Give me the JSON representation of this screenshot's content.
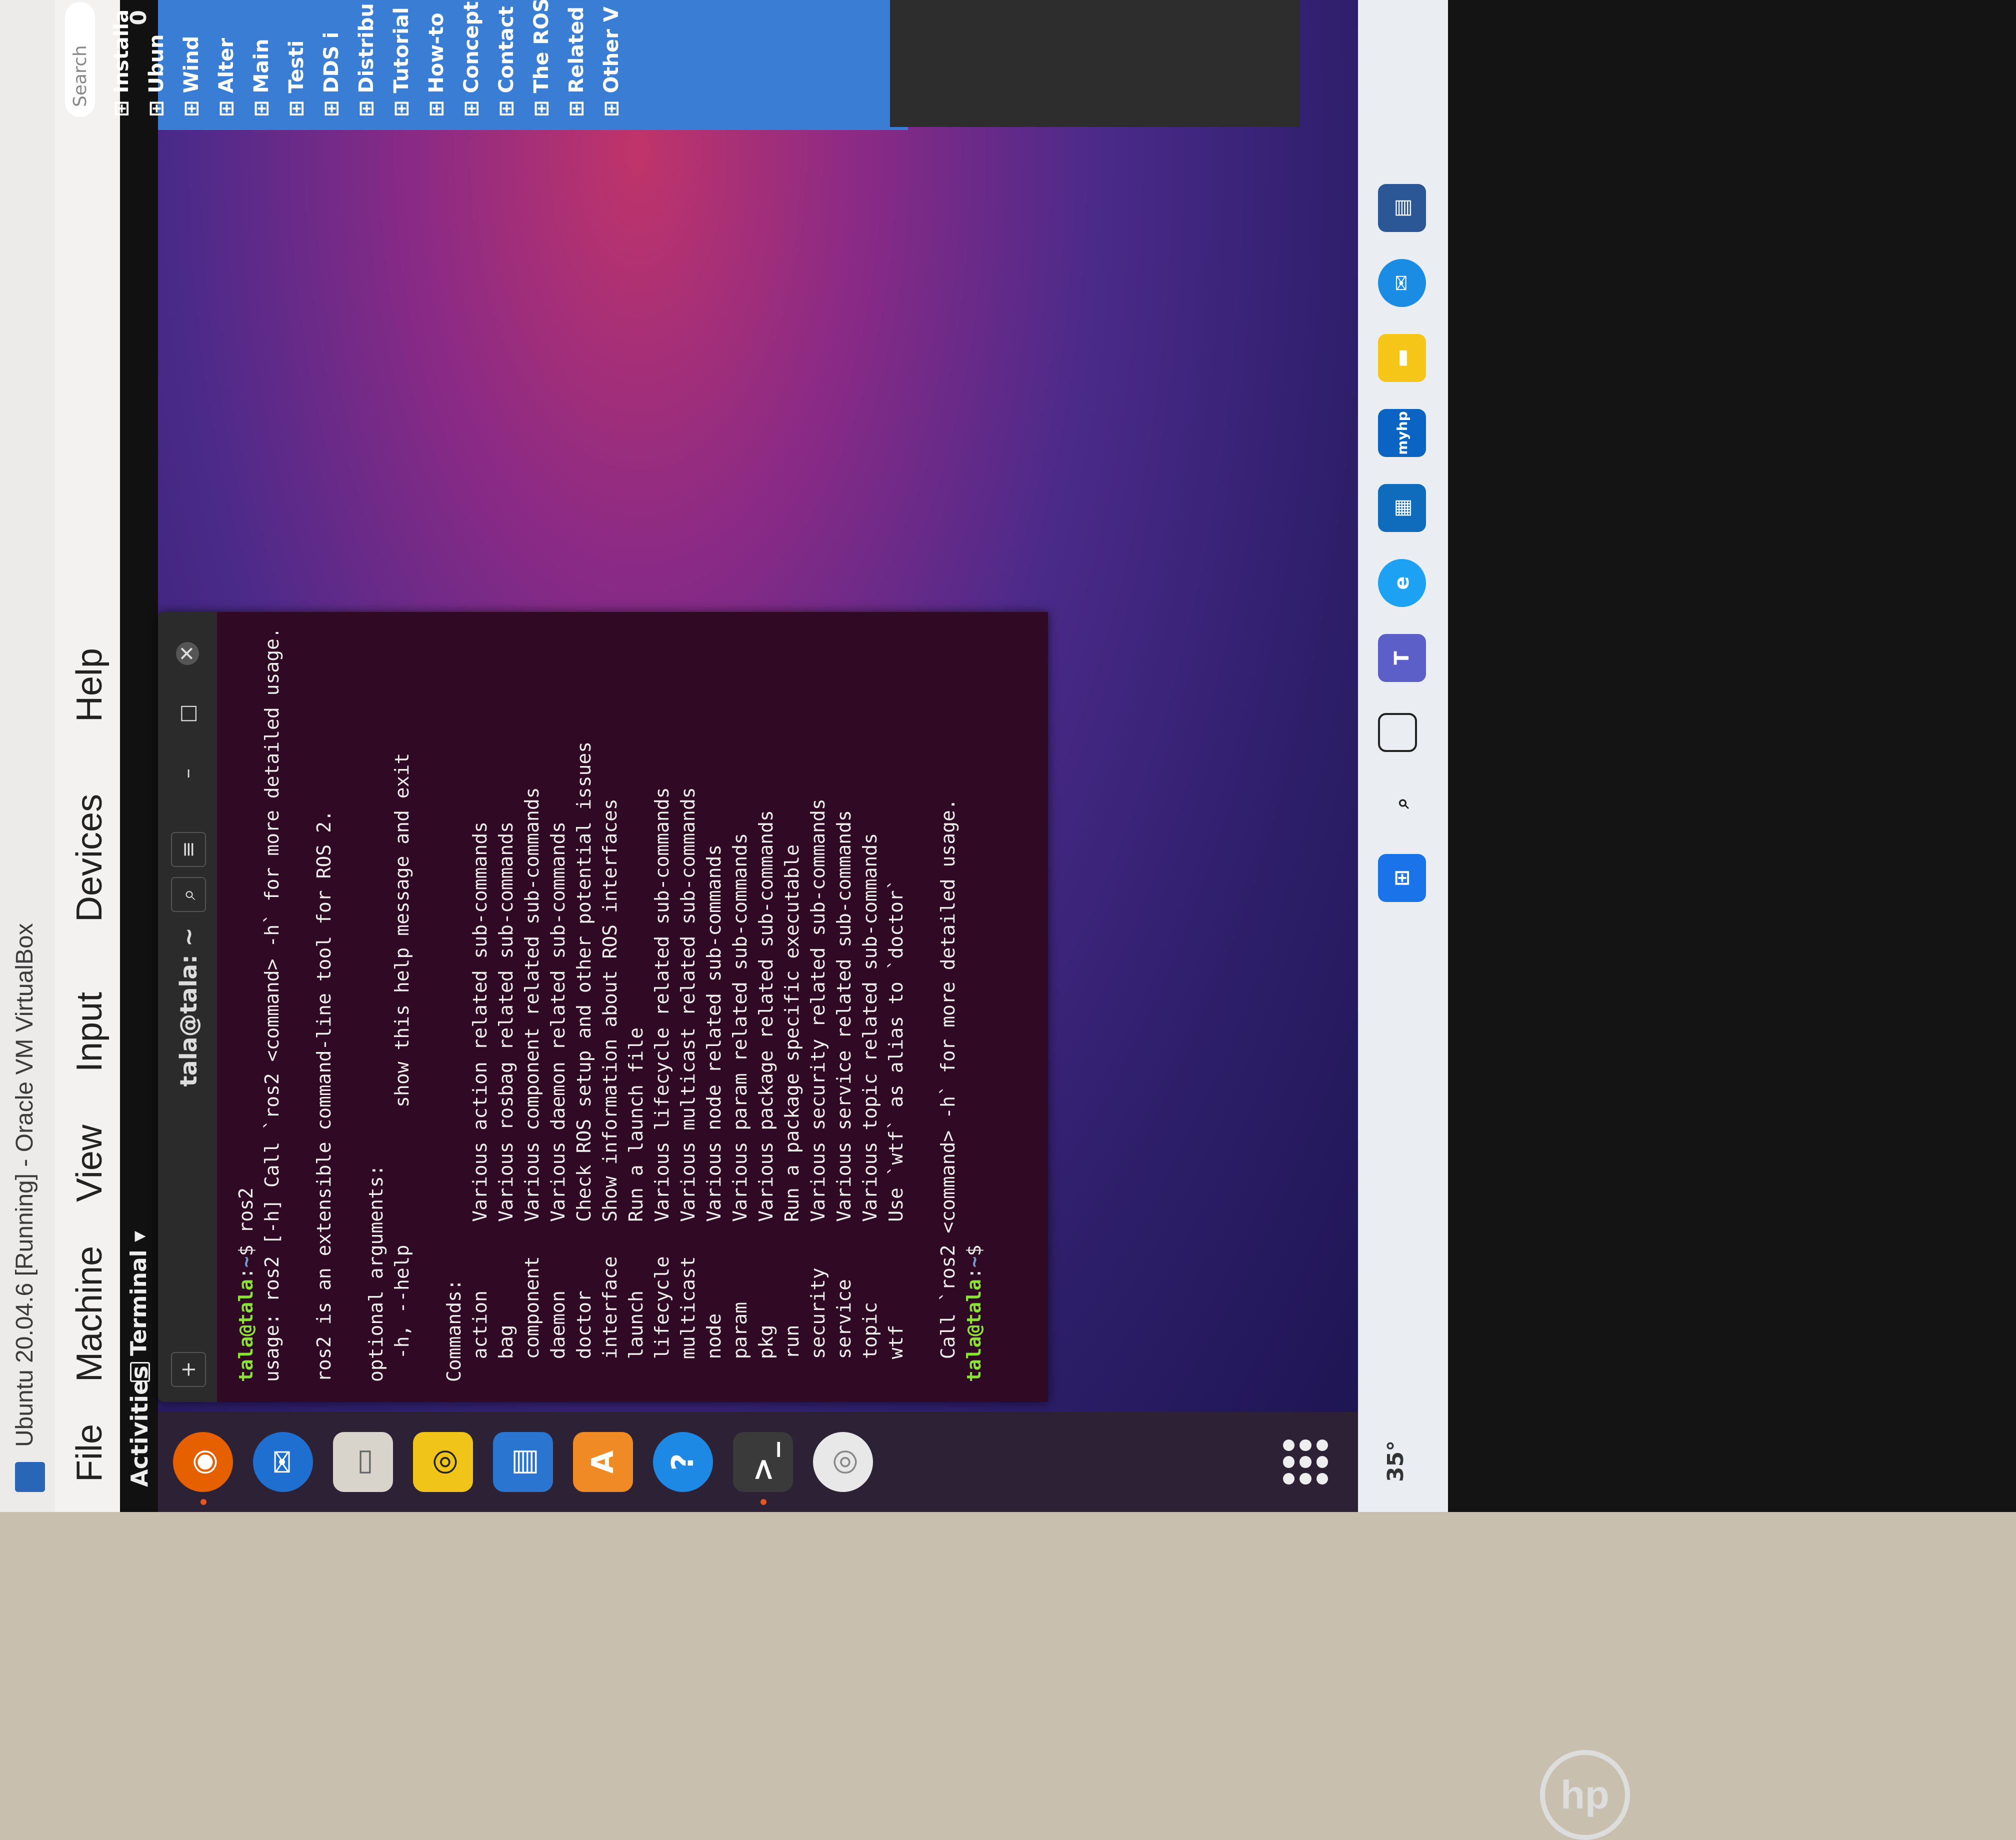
{
  "vbox": {
    "title": "Ubuntu 20.04.6 [Running] - Oracle VM VirtualBox",
    "menu": [
      "File",
      "Machine",
      "View",
      "Input",
      "Devices",
      "Help"
    ]
  },
  "topbar": {
    "activities": "Activities",
    "app_menu": "Terminal ▾",
    "clock": "0"
  },
  "terminal": {
    "title": "tala@tala: ~",
    "prompt_user": "tala@tala",
    "prompt_path": "~",
    "command": "ros2",
    "usage_line": "usage: ros2 [-h] Call `ros2 <command> -h` for more detailed usage. ...",
    "description": "ros2 is an extensible command-line tool for ROS 2.",
    "optional_header": "optional arguments:",
    "help_flag": "  -h, --help            show this help message and exit",
    "commands_header": "Commands:",
    "commands": [
      {
        "name": "action",
        "desc": "Various action related sub-commands"
      },
      {
        "name": "bag",
        "desc": "Various rosbag related sub-commands"
      },
      {
        "name": "component",
        "desc": "Various component related sub-commands"
      },
      {
        "name": "daemon",
        "desc": "Various daemon related sub-commands"
      },
      {
        "name": "doctor",
        "desc": "Check ROS setup and other potential issues"
      },
      {
        "name": "interface",
        "desc": "Show information about ROS interfaces"
      },
      {
        "name": "launch",
        "desc": "Run a launch file"
      },
      {
        "name": "lifecycle",
        "desc": "Various lifecycle related sub-commands"
      },
      {
        "name": "multicast",
        "desc": "Various multicast related sub-commands"
      },
      {
        "name": "node",
        "desc": "Various node related sub-commands"
      },
      {
        "name": "param",
        "desc": "Various param related sub-commands"
      },
      {
        "name": "pkg",
        "desc": "Various package related sub-commands"
      },
      {
        "name": "run",
        "desc": "Run a package specific executable"
      },
      {
        "name": "security",
        "desc": "Various security related sub-commands"
      },
      {
        "name": "service",
        "desc": "Various service related sub-commands"
      },
      {
        "name": "topic",
        "desc": "Various topic related sub-commands"
      },
      {
        "name": "wtf",
        "desc": "Use `wtf` as alias to `doctor`"
      }
    ],
    "footer": "  Call `ros2 <command> -h` for more detailed usage."
  },
  "docs_panel": {
    "search_placeholder": "Search",
    "items": [
      "Installa",
      "Ubun",
      "Wind",
      "Alter",
      "Main",
      "Testi",
      "DDS i",
      "Distribu",
      "Tutorial",
      "How-to",
      "Concept",
      "Contact",
      "The ROS",
      "Related",
      "Other V"
    ]
  },
  "taskbar": {
    "weather": "35°",
    "icons": [
      "start-icon",
      "search-icon",
      "task-view-icon",
      "teams-icon",
      "edge-icon",
      "store-icon",
      "myhp-icon",
      "file-explorer-icon",
      "outlook-icon",
      "calculator-icon"
    ]
  },
  "dock": {
    "icons": [
      "firefox-icon",
      "thunderbird-icon",
      "files-icon",
      "rhythmbox-icon",
      "writer-icon",
      "software-icon",
      "help-icon",
      "terminal-icon",
      "dvd-icon"
    ]
  },
  "colors": {
    "terminal_bg": "#300a24",
    "prompt_user": "#8ae234",
    "prompt_path": "#729fcf",
    "ubuntu_accent": "#e95420"
  }
}
